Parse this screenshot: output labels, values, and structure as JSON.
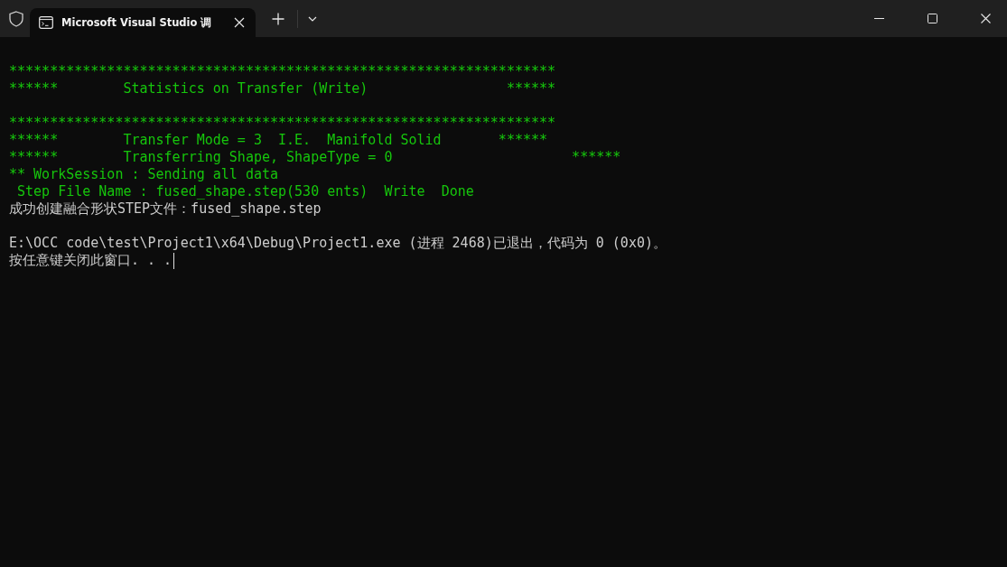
{
  "tab": {
    "title": "Microsoft Visual Studio 调"
  },
  "console": {
    "blocks": [
      {
        "lines": [
          {
            "kind": "program",
            "cursor": false,
            "text": "*******************************************************************"
          },
          {
            "kind": "program",
            "cursor": false,
            "text": "******        Statistics on Transfer (Write)                 ******"
          }
        ]
      },
      {
        "lines": [
          {
            "kind": "program",
            "cursor": false,
            "text": "*******************************************************************"
          },
          {
            "kind": "program",
            "cursor": false,
            "text": "******        Transfer Mode = 3  I.E.  Manifold Solid       ******"
          },
          {
            "kind": "program",
            "cursor": false,
            "text": "******        Transferring Shape, ShapeType = 0                      ******"
          },
          {
            "kind": "program",
            "cursor": false,
            "text": "** WorkSession : Sending all data"
          },
          {
            "kind": "program",
            "cursor": false,
            "text": " Step File Name : fused_shape.step(530 ents)  Write  Done"
          },
          {
            "kind": "plain",
            "cursor": false,
            "text": "成功创建融合形状STEP文件：fused_shape.step"
          }
        ]
      },
      {
        "lines": [
          {
            "kind": "plain",
            "cursor": false,
            "text": "E:\\OCC code\\test\\Project1\\x64\\Debug\\Project1.exe (进程 2468)已退出，代码为 0 (0x0)。"
          },
          {
            "kind": "plain",
            "cursor": true,
            "text": "按任意键关闭此窗口. . ."
          }
        ]
      }
    ]
  }
}
